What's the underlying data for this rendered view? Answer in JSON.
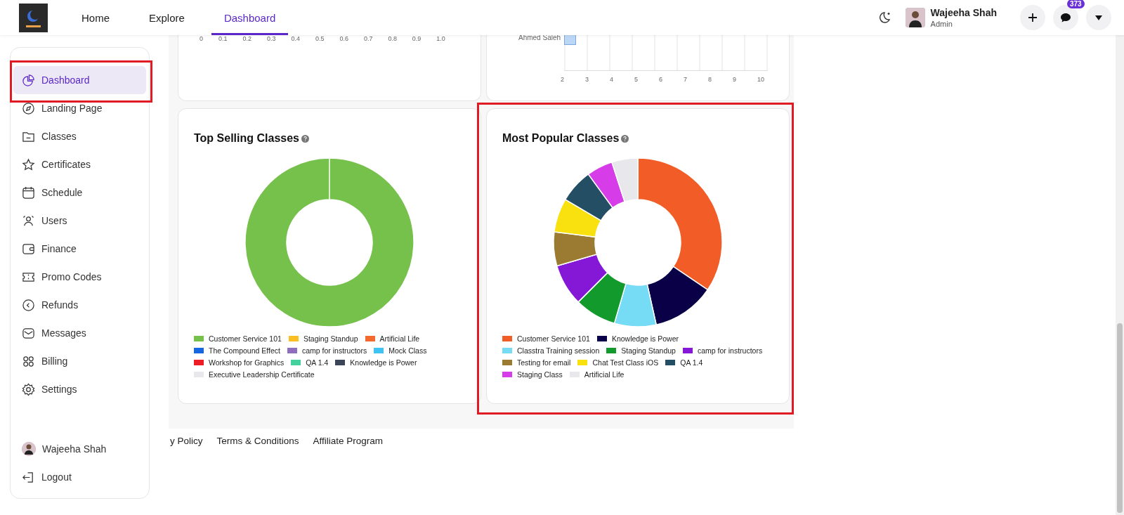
{
  "header": {
    "nav": [
      {
        "label": "Home",
        "selected": false
      },
      {
        "label": "Explore",
        "selected": false
      },
      {
        "label": "Dashboard",
        "selected": true
      }
    ],
    "user": {
      "name": "Wajeeha Shah",
      "role": "Admin"
    },
    "message_badge": "373"
  },
  "sidebar": {
    "items": [
      {
        "label": "Dashboard",
        "selected": true,
        "highlighted": true
      },
      {
        "label": "Landing Page",
        "selected": false,
        "highlighted": false
      },
      {
        "label": "Classes",
        "selected": false,
        "highlighted": false
      },
      {
        "label": "Certificates",
        "selected": false,
        "highlighted": false
      },
      {
        "label": "Schedule",
        "selected": false,
        "highlighted": false
      },
      {
        "label": "Users",
        "selected": false,
        "highlighted": false
      },
      {
        "label": "Finance",
        "selected": false,
        "highlighted": false
      },
      {
        "label": "Promo Codes",
        "selected": false,
        "highlighted": false
      },
      {
        "label": "Refunds",
        "selected": false,
        "highlighted": false
      },
      {
        "label": "Messages",
        "selected": false,
        "highlighted": false
      },
      {
        "label": "Billing",
        "selected": false,
        "highlighted": false
      },
      {
        "label": "Settings",
        "selected": false,
        "highlighted": false
      }
    ],
    "user": "Wajeeha Shah",
    "logout": "Logout"
  },
  "top_cards": [
    {
      "x_ticks": [
        "0",
        "0.1",
        "0.2",
        "0.3",
        "0.4",
        "0.5",
        "0.6",
        "0.7",
        "0.8",
        "0.9",
        "1.0"
      ]
    },
    {
      "row_label": "Ahmed Saleh",
      "x_ticks": [
        "2",
        "3",
        "4",
        "5",
        "6",
        "7",
        "8",
        "9",
        "10"
      ]
    }
  ],
  "cards": [
    {
      "title": "Top Selling Classes",
      "highlighted": false,
      "legend": [
        {
          "label": "Customer Service 101",
          "color": "#76c04c"
        },
        {
          "label": "Staging Standup",
          "color": "#fbbf24"
        },
        {
          "label": "Artificial Life",
          "color": "#f26a2e"
        },
        {
          "label": "The Compound Effect",
          "color": "#1767e0"
        },
        {
          "label": "camp for instructors",
          "color": "#8e6fbf"
        },
        {
          "label": "Mock Class",
          "color": "#3ec3f2"
        },
        {
          "label": "Workshop for Graphics",
          "color": "#ee1c25"
        },
        {
          "label": "QA 1.4",
          "color": "#45d19d"
        },
        {
          "label": "Knowledge is Power",
          "color": "#3b4658"
        },
        {
          "label": "Executive Leadership Certificate",
          "color": "#e8e8ec"
        }
      ]
    },
    {
      "title": "Most Popular Classes",
      "highlighted": true,
      "legend": [
        {
          "label": "Customer Service 101",
          "color": "#f25c26"
        },
        {
          "label": "Knowledge is Power",
          "color": "#0a0048"
        },
        {
          "label": "Classtra Training session",
          "color": "#76dcf5"
        },
        {
          "label": "Staging Standup",
          "color": "#129a2c"
        },
        {
          "label": "camp for instructors",
          "color": "#8518d6"
        },
        {
          "label": "Testing for email",
          "color": "#9a7b31"
        },
        {
          "label": "Chat Test Class iOS",
          "color": "#f8e10f"
        },
        {
          "label": "QA 1.4",
          "color": "#234e63"
        },
        {
          "label": "Staging Class",
          "color": "#d63ce8"
        },
        {
          "label": "Artificial Life",
          "color": "#e8e7ec"
        }
      ]
    }
  ],
  "footer_links": [
    "y Policy",
    "Terms & Conditions",
    "Affiliate Program"
  ]
}
